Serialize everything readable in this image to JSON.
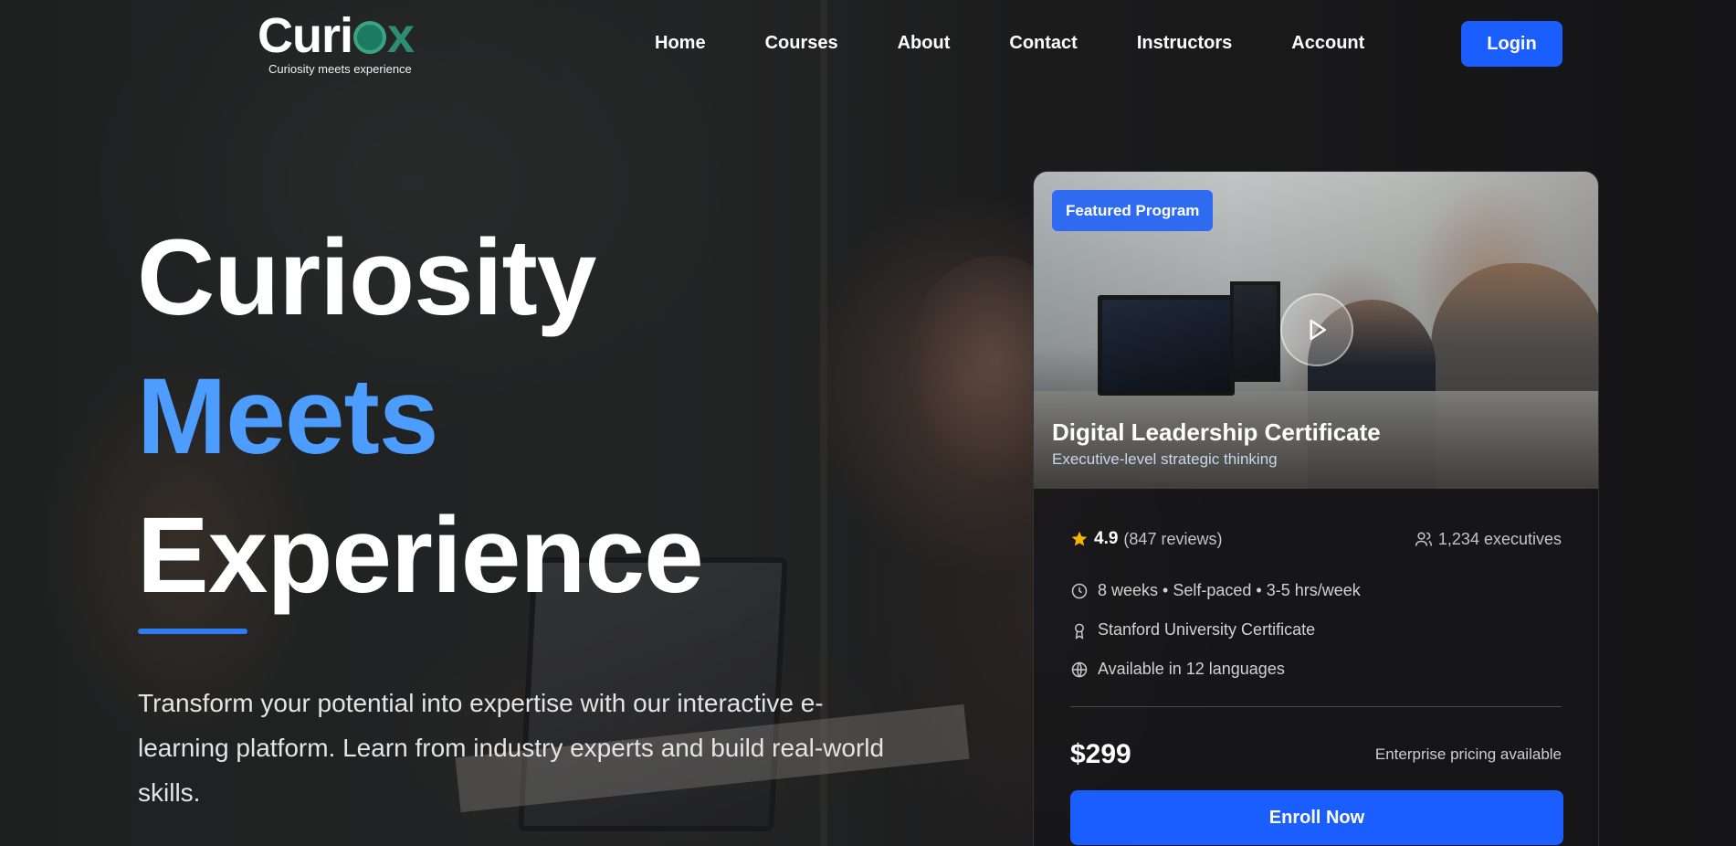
{
  "brand": {
    "logo_text_start": "Curi",
    "logo_text_end": "x",
    "tagline": "Curiosity meets experience"
  },
  "nav": {
    "items": [
      {
        "label": "Home"
      },
      {
        "label": "Courses"
      },
      {
        "label": "About"
      },
      {
        "label": "Contact"
      },
      {
        "label": "Instructors"
      },
      {
        "label": "Account"
      }
    ],
    "login_label": "Login"
  },
  "hero": {
    "line1": "Curiosity",
    "line2": "Meets",
    "line3": "Experience",
    "description": "Transform your potential into expertise with our interactive e-learning platform. Learn from industry experts and build real-world skills."
  },
  "card": {
    "badge": "Featured Program",
    "title": "Digital Leadership Certificate",
    "subtitle": "Executive-level strategic thinking",
    "rating": "4.9",
    "reviews": "(847 reviews)",
    "learners": "1,234 executives",
    "duration": "8 weeks • Self-paced • 3-5 hrs/week",
    "certificate": "Stanford University Certificate",
    "languages": "Available in 12 languages",
    "price": "$299",
    "pricing_note": "Enterprise pricing available",
    "enroll_label": "Enroll Now"
  },
  "colors": {
    "accent": "#1a5eff",
    "hero_highlight": "#4d9cff",
    "star": "#f5b400",
    "logo_green": "#2e8d6e"
  },
  "icons": {
    "star": "star-icon",
    "users": "users-icon",
    "clock": "clock-icon",
    "award": "award-icon",
    "globe": "globe-icon",
    "play": "play-icon"
  }
}
